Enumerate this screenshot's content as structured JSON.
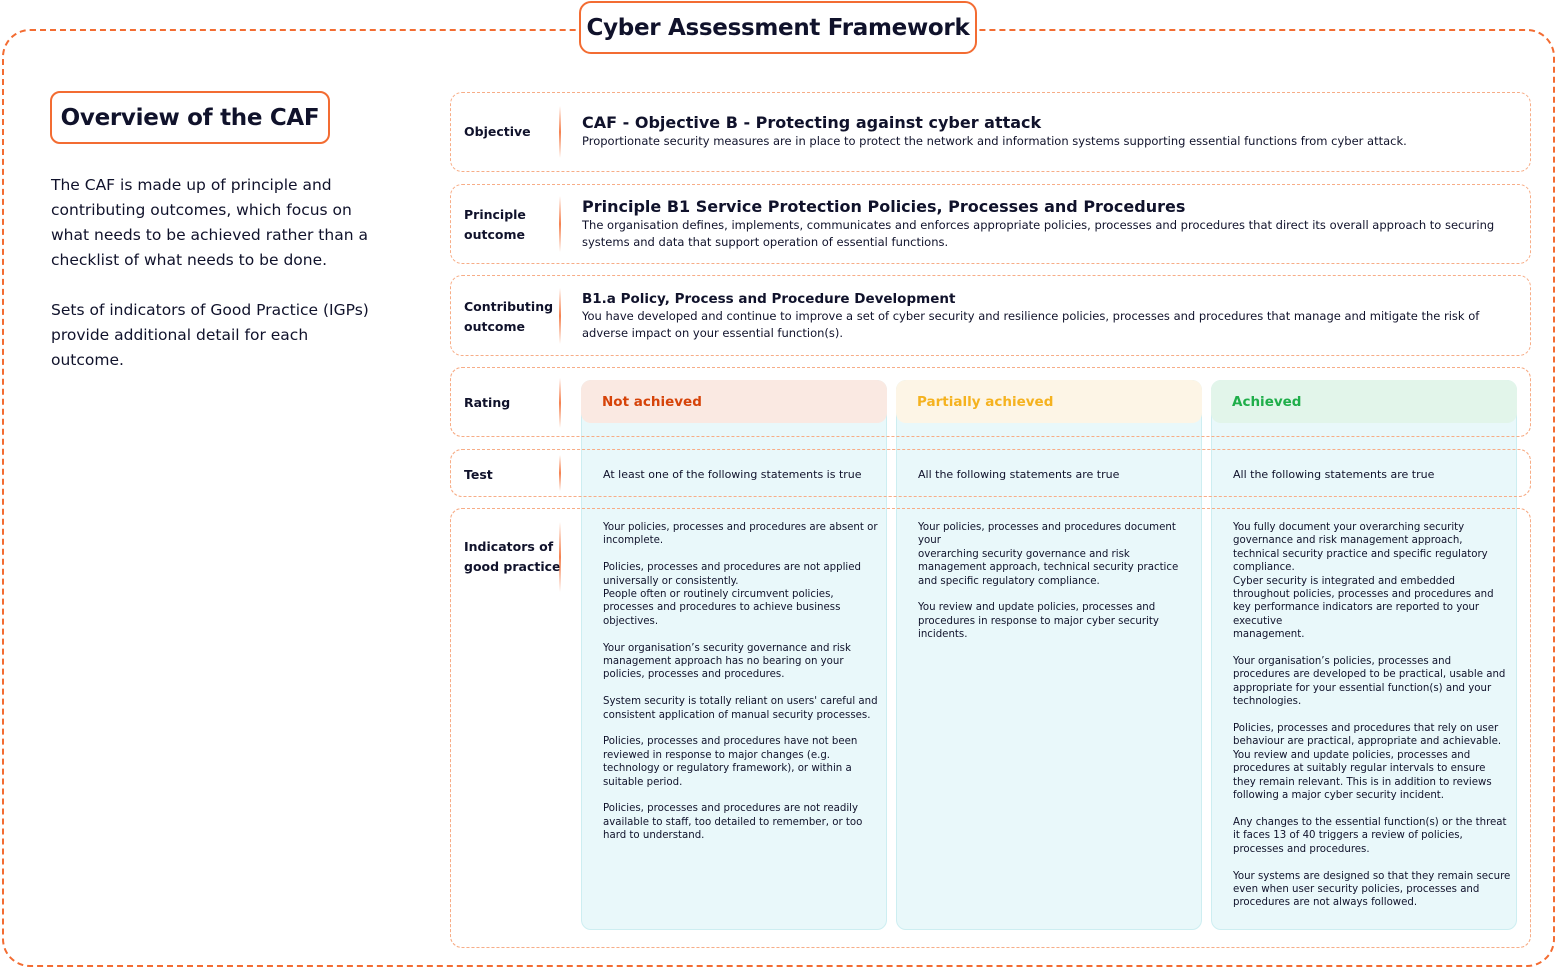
{
  "header": {
    "title": "Cyber Assessment Framework"
  },
  "overview": {
    "title": "Overview of the CAF",
    "paragraphs": [
      "The CAF is made up of principle and contributing outcomes, which focus on what needs to be achieved rather than a checklist of what needs to be done.",
      "Sets of indicators of Good Practice (IGPs) provide additional detail for each outcome."
    ]
  },
  "rows": {
    "objective": {
      "label": "Objective",
      "heading": "CAF - Objective B - Protecting against cyber attack",
      "description": "Proportionate security measures are in place to protect the network and information systems supporting essential functions from cyber attack."
    },
    "principle": {
      "label_line1": "Principle",
      "label_line2": "outcome",
      "heading": "Principle B1 Service Protection Policies, Processes and Procedures",
      "description": "The organisation defines, implements, communicates and enforces appropriate policies, processes and procedures that direct its overall approach to securing systems and data that support operation of essential functions."
    },
    "contributing": {
      "label_line1": "Contributing",
      "label_line2": "outcome",
      "heading": "B1.a Policy, Process and Procedure Development",
      "description": "You have developed and continue to improve a set of cyber security and resilience policies, processes and procedures that manage and mitigate the risk of adverse impact on your essential function(s)."
    },
    "rating": {
      "label": "Rating"
    },
    "test": {
      "label": "Test"
    },
    "indicators": {
      "label_line1": "Indicators of",
      "label_line2": "good practice"
    }
  },
  "ratings": [
    {
      "name": "Not achieved",
      "color": "#d64309",
      "header_bg": "#fae9e2",
      "test": "At least one of the following statements is true",
      "indicators": [
        "Your policies, processes and procedures are absent or incomplete.",
        "Policies, processes and procedures are not applied universally or consistently.\nPeople often or routinely circumvent policies, processes and procedures to achieve business objectives.",
        "Your organisation’s security governance and risk management approach has no bearing on your policies, processes and procedures.",
        "System security is totally reliant on users' careful and consistent application of manual security processes.",
        "Policies, processes and procedures have not been reviewed in response to major changes (e.g. technology or regulatory framework), or within a suitable period.",
        "Policies, processes and procedures are not readily available to staff, too detailed to remember, or too hard to understand."
      ]
    },
    {
      "name": "Partially achieved",
      "color": "#f5b21f",
      "header_bg": "#fdf5e6",
      "test": "All the following statements  are true",
      "indicators": [
        "Your policies, processes and procedures document your\noverarching security governance and risk management approach, technical security practice and specific regulatory compliance.",
        "You review and update policies, processes and procedures in response to major cyber security incidents."
      ]
    },
    {
      "name": "Achieved",
      "color": "#1fae4a",
      "header_bg": "#e2f5ea",
      "test": "All the following statements are true",
      "indicators": [
        "You fully document your overarching security governance and risk management approach, technical security practice and specific regulatory compliance.\nCyber security is integrated and embedded throughout policies, processes and procedures and key performance indicators are reported to your executive\nmanagement.",
        "Your organisation’s policies, processes and procedures are developed to be practical, usable and appropriate for your essential function(s) and your technologies.",
        "Policies, processes and procedures that rely on user behaviour are practical, appropriate and achievable.\nYou review and update policies, processes and procedures at suitably regular intervals to ensure they remain relevant. This is in addition to reviews following a major cyber security incident.",
        "Any changes to the essential function(s) or the threat it faces 13 of 40 triggers a review of policies, processes and procedures.",
        "Your systems are designed so that they remain secure even when user security policies, processes and procedures are not always followed."
      ]
    }
  ]
}
